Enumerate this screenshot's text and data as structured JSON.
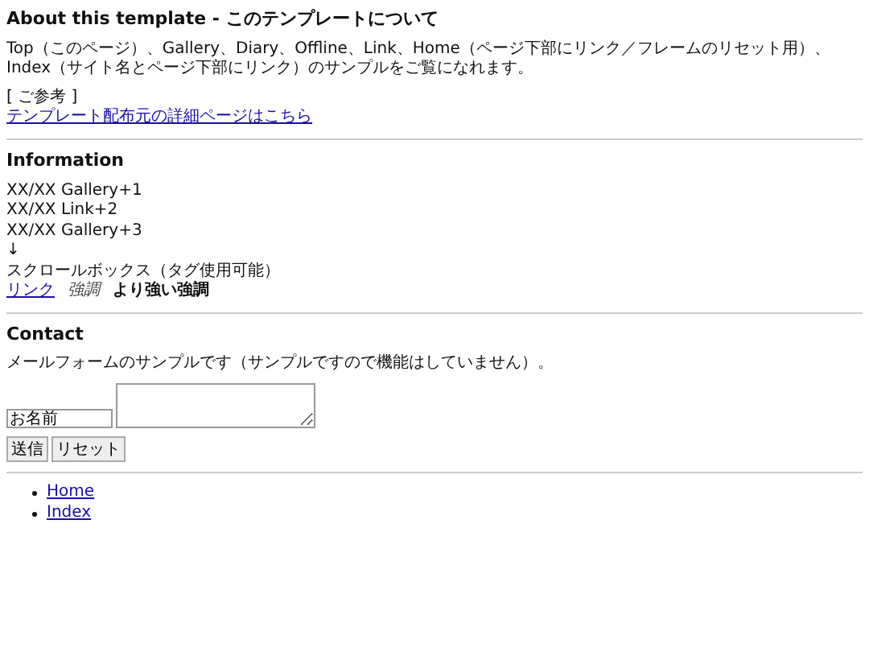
{
  "about": {
    "heading": "About this template - このテンプレートについて",
    "text": "Top（このページ）、Gallery、Diary、Offline、Link、Home（ページ下部にリンク／フレームのリセット用）、Index（サイト名とページ下部にリンク）のサンプルをご覧になれます。",
    "note": "[ ご参考 ]",
    "link": "テンプレート配布元の詳細ページはこちら"
  },
  "information": {
    "heading": "Information",
    "lines": [
      "XX/XX Gallery+1",
      "XX/XX Link+2",
      "XX/XX Gallery+3",
      "↓",
      "スクロールボックス（タグ使用可能）"
    ],
    "styles": [
      {
        "kind": "link",
        "text": "リンク"
      },
      {
        "kind": "em",
        "text": "強調"
      },
      {
        "kind": "strong",
        "text": "より強い強調"
      }
    ]
  },
  "contact": {
    "heading": "Contact",
    "text": "メールフォームのサンプルです（サンプルですので機能はしていません）。",
    "name_field": {
      "value": "お名前"
    },
    "buttons": [
      "送信",
      "リセット"
    ]
  },
  "nav": [
    "Home",
    "Index"
  ]
}
